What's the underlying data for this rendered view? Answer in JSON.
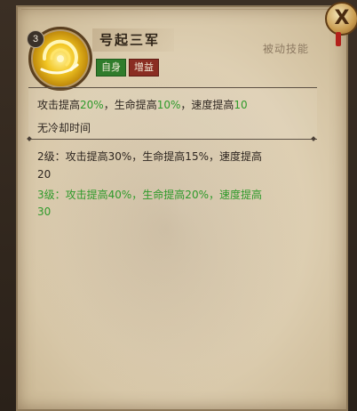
{
  "close": {
    "icon": "close-icon",
    "label": "X"
  },
  "skill": {
    "level": "3",
    "name": "号起三军",
    "icon": "golden-swirl-icon",
    "tags": [
      {
        "label": "自身",
        "color": "#2f7c2c"
      },
      {
        "label": "增益",
        "color": "#8a2d22"
      }
    ],
    "type_label": "被动技能"
  },
  "current_effect": {
    "part1": "攻击提高",
    "v1": "20%",
    "part2": "，生命提高",
    "v2": "10%",
    "part3": "，速度提高",
    "v3": "10",
    "cooldown": "无冷却时间"
  },
  "upgrades": [
    {
      "line1": "2级：攻击提高30%，生命提高15%，速度提高",
      "line2": "20",
      "active": false
    },
    {
      "line1": "3级：攻击提高40%，生命提高20%，速度提高",
      "line2": "30",
      "active": true
    }
  ],
  "colors": {
    "highlight_green": "#2f9a2b",
    "tag_self": "#2f7c2c",
    "tag_buff": "#8a2d22"
  }
}
